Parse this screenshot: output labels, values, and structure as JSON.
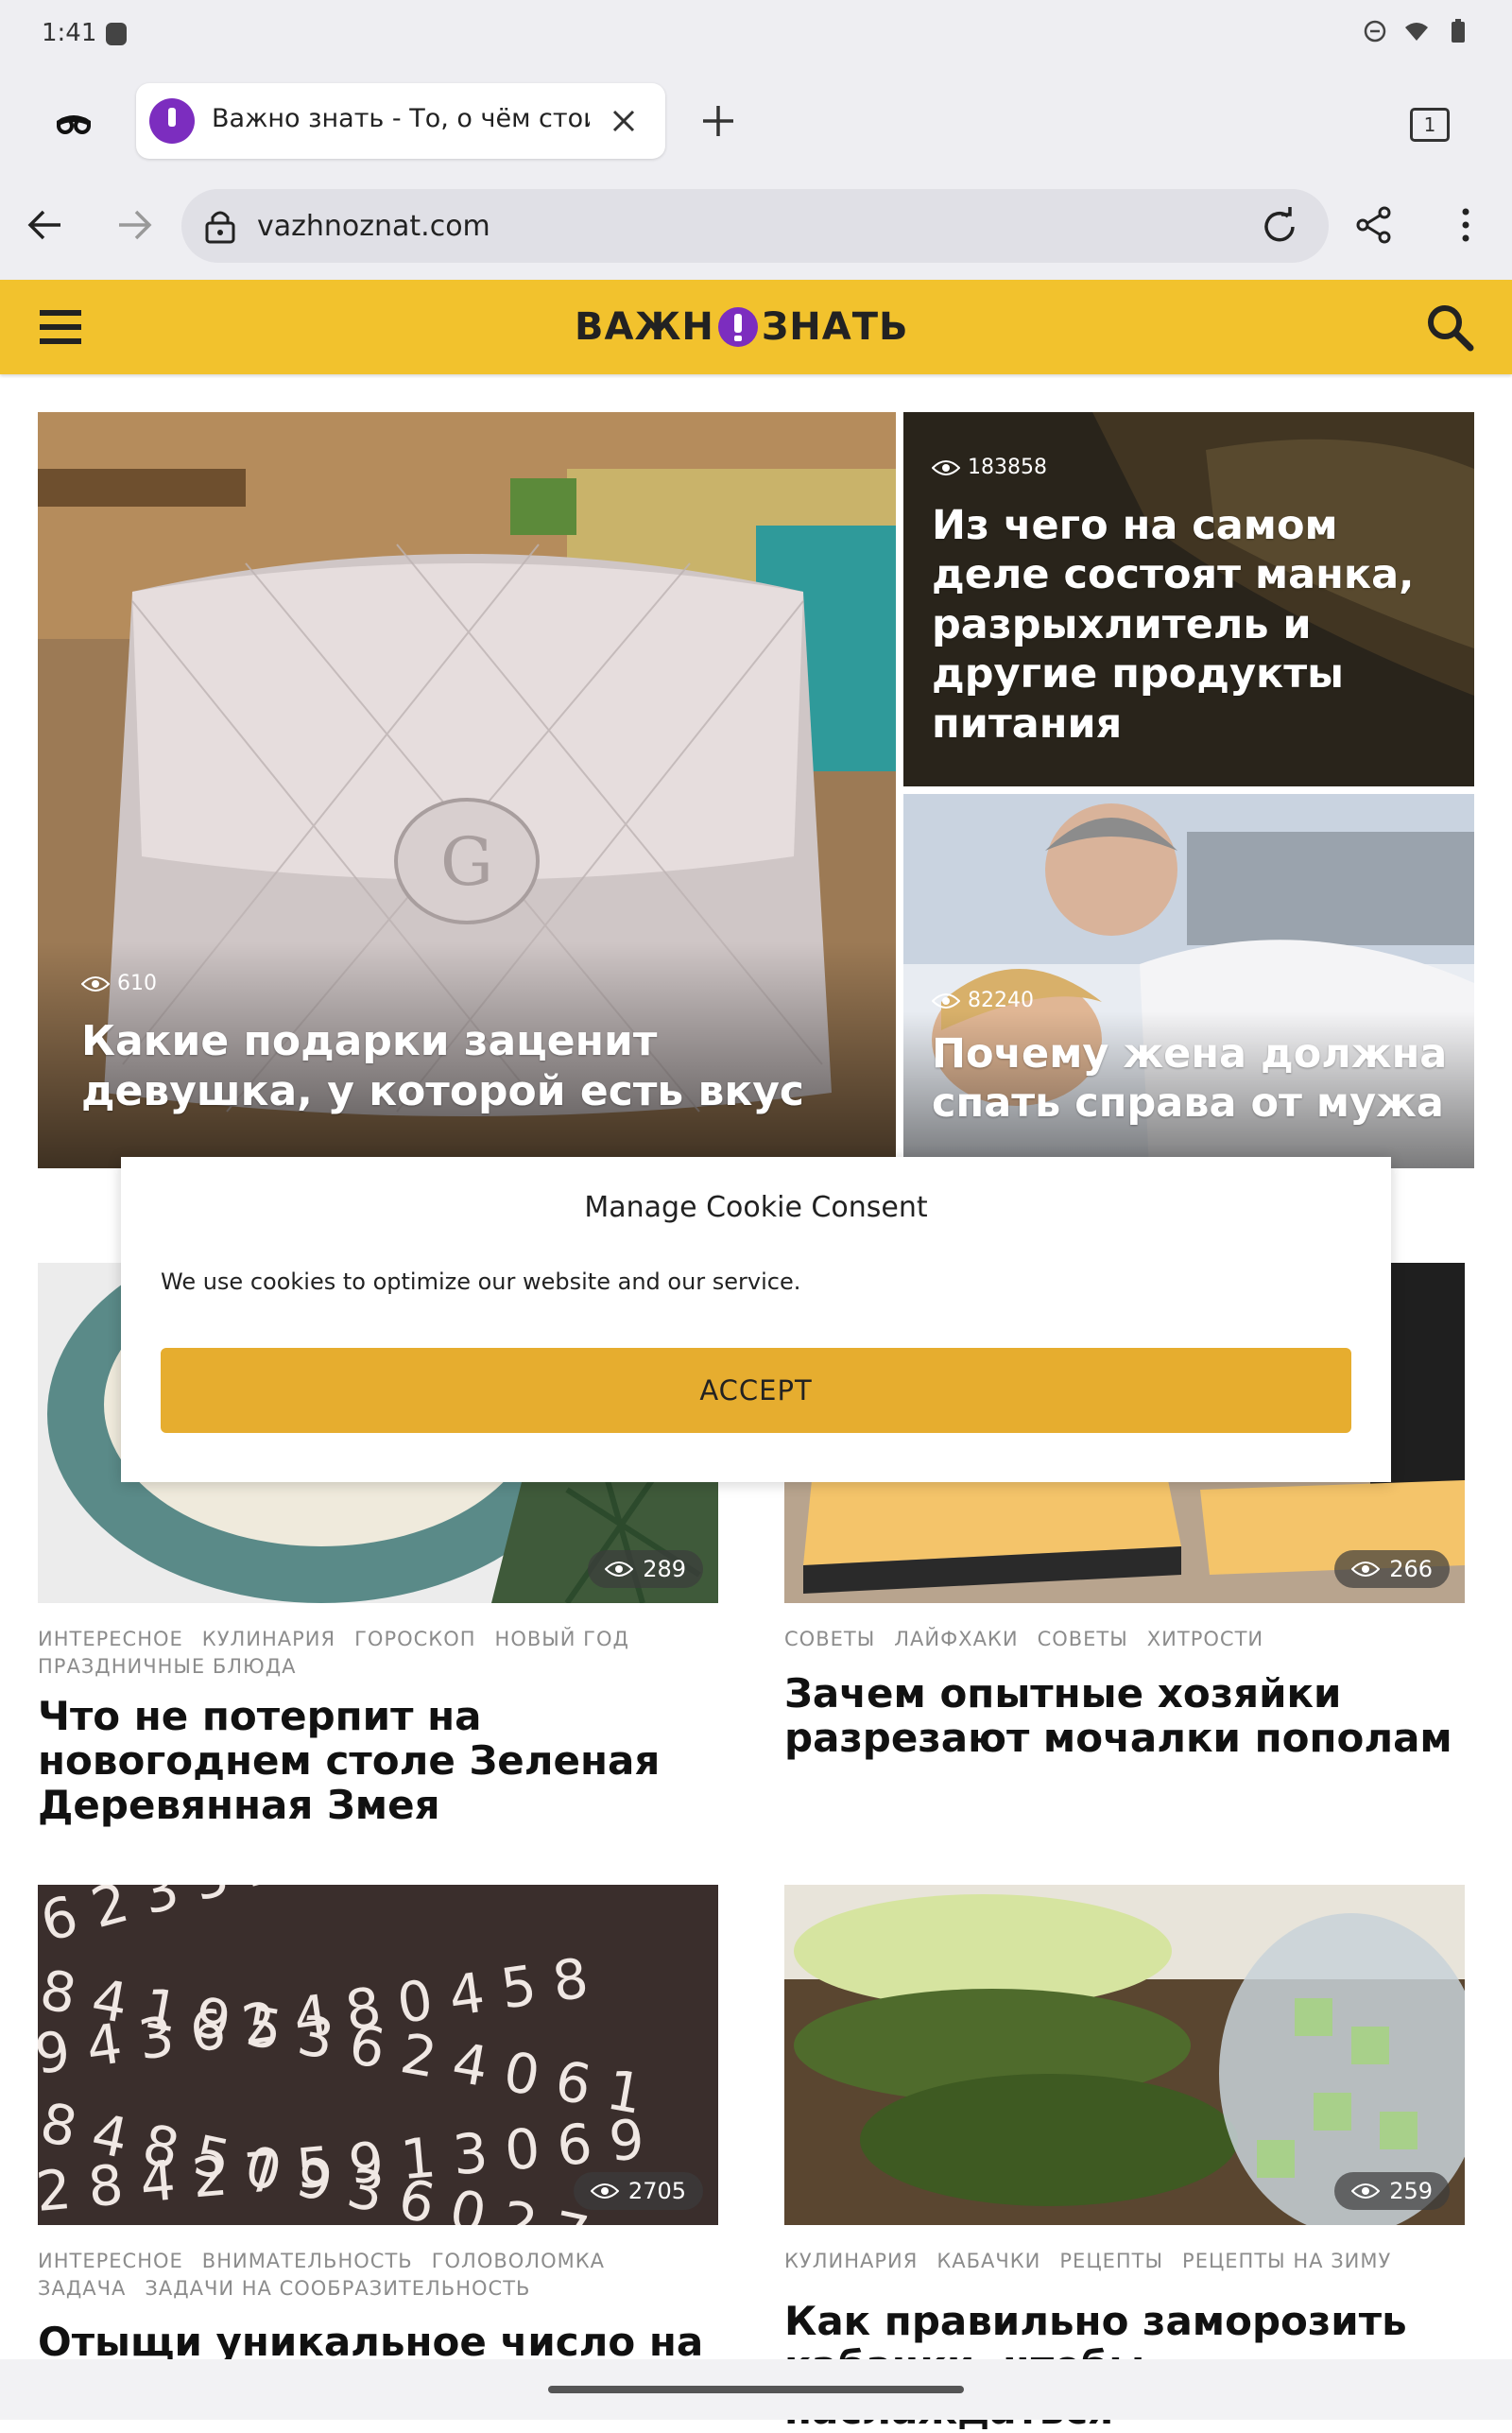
{
  "status_bar": {
    "time": "1:41"
  },
  "browser": {
    "tab_title": "Важно знать - То, о чём стоит",
    "tab_count": "1",
    "url": "vazhnoznat.com"
  },
  "site": {
    "logo_left": "ВАЖН",
    "logo_right": "ЗНАТЬ",
    "accent_color": "#f2c22d",
    "brand_color": "#7c2dbf"
  },
  "hero": [
    {
      "views": "610",
      "title": "Какие подарки заценит девушка, у которой есть вкус"
    },
    {
      "views": "183858",
      "title": "Из чего на самом деле состоят манка, разрыхлитель и другие продукты питания"
    },
    {
      "views": "82240",
      "title": "Почему жена должна спать справа от мужа"
    }
  ],
  "cards": [
    {
      "views": "289",
      "categories": [
        "ИНТЕРЕСНОЕ",
        "КУЛИНАРИЯ",
        "ГОРОСКОП",
        "НОВЫЙ ГОД",
        "ПРАЗДНИЧНЫЕ БЛЮДА"
      ],
      "title": "Что не потерпит на новогоднем столе Зеленая Деревянная Змея"
    },
    {
      "views": "266",
      "categories": [
        "СОВЕТЫ",
        "ЛАЙФХАКИ",
        "СОВЕТЫ",
        "ХИТРОСТИ"
      ],
      "title": "Зачем опытные хозяйки разрезают мочалки пополам"
    },
    {
      "views": "2705",
      "categories": [
        "ИНТЕРЕСНОЕ",
        "ВНИМАТЕЛЬНОСТЬ",
        "ГОЛОВОЛОМКА",
        "ЗАДАЧА",
        "ЗАДАЧИ НА СООБРАЗИТЕЛЬНОСТЬ"
      ],
      "title": "Отыщи уникальное число на"
    },
    {
      "views": "259",
      "categories": [
        "КУЛИНАРИЯ",
        "КАБАЧКИ",
        "РЕЦЕПТЫ",
        "РЕЦЕПТЫ НА ЗИМУ"
      ],
      "title": "Как правильно заморозить кабачки, чтобы наслаждаться"
    }
  ],
  "cookie": {
    "title": "Manage Cookie Consent",
    "text": "We use cookies to optimize our website and our service.",
    "accept_label": "ACCEPT",
    "accept_color": "#e6ad2f"
  },
  "icons": {
    "incognito": "incognito-icon",
    "close": "close-icon",
    "add": "plus-icon",
    "back": "arrow-left-icon",
    "forward": "arrow-right-icon",
    "lock": "lock-icon",
    "reload": "reload-icon",
    "share": "share-icon",
    "more": "more-vert-icon",
    "menu": "hamburger-icon",
    "search": "search-icon",
    "views": "eye-icon"
  }
}
